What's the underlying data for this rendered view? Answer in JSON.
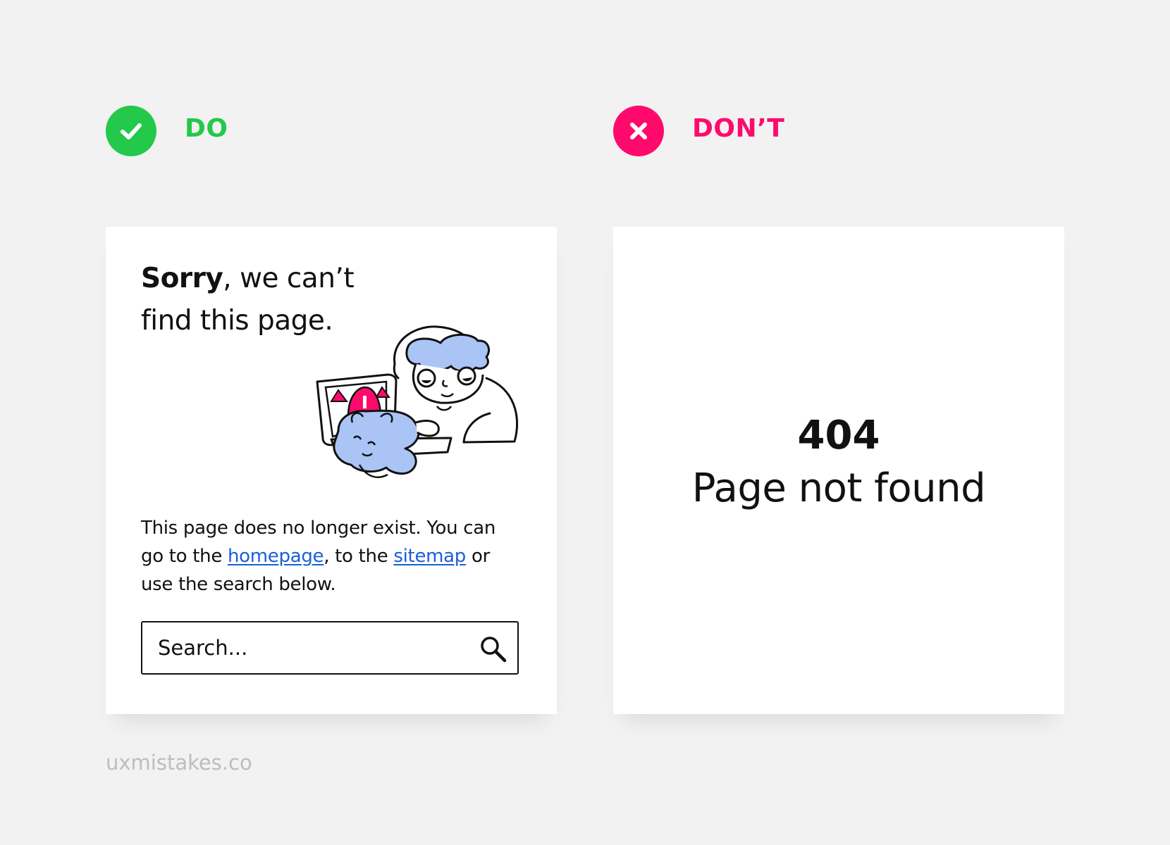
{
  "do_section": {
    "label": "DO",
    "color": "#22c94a",
    "icon": "checkmark-icon",
    "card": {
      "headline_bold": "Sorry",
      "headline_rest_1": ", we can’t",
      "headline_line_2": "find this page.",
      "illustration": "person-with-cat-and-error-laptop-illustration",
      "body_intro": "This page does no longer exist. You can go to the ",
      "homepage_link": "homepage",
      "body_middle": ", to the ",
      "sitemap_link": "sitemap",
      "body_end": " or use the search below.",
      "link_color": "#1a5fd6",
      "search": {
        "placeholder": "Search...",
        "icon": "search-icon"
      }
    }
  },
  "dont_section": {
    "label": "DON’T",
    "color": "#ff0a6c",
    "icon": "close-icon",
    "card": {
      "error_code": "404",
      "error_message": "Page not found"
    }
  },
  "footer": {
    "credit": "uxmistakes.co"
  }
}
